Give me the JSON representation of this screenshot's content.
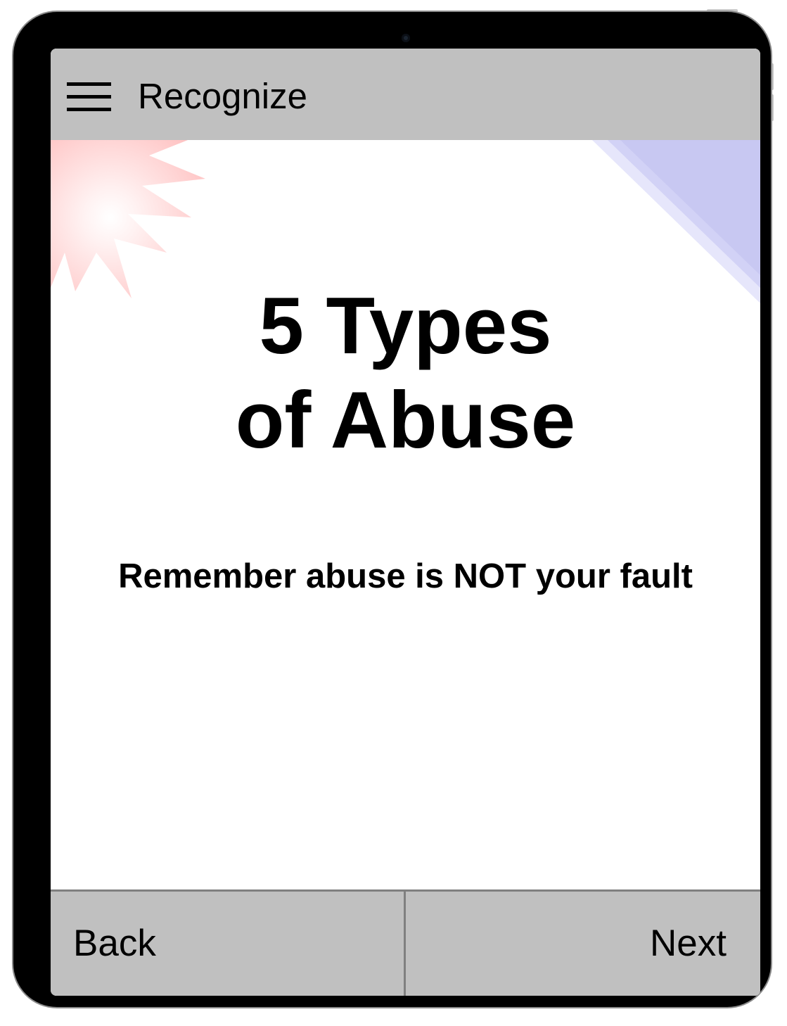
{
  "header": {
    "title": "Recognize",
    "menu_icon": "hamburger-menu-icon"
  },
  "main": {
    "heading_line1": "5 Types",
    "heading_line2": "of Abuse",
    "subtitle": "Remember abuse is NOT your fault"
  },
  "footer": {
    "back_label": "Back",
    "next_label": "Next"
  },
  "colors": {
    "bar_gray": "#c0c0c0",
    "divider_gray": "#808080",
    "burst_red": "#ffc8c8",
    "corner_blue": "#c8c8f2",
    "text": "#000000"
  }
}
